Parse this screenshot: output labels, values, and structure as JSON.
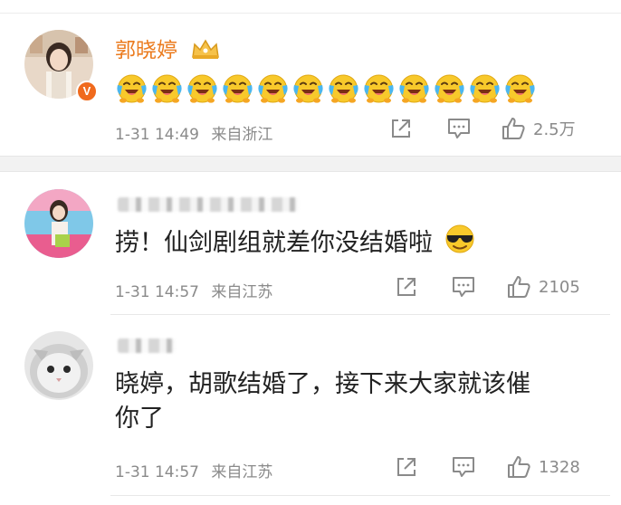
{
  "comments": [
    {
      "username": "郭晓婷",
      "emoji_count": 12,
      "emoji_name": "laughing-tears-emoji",
      "time": "1-31 14:49",
      "source": "来自浙江",
      "likes": "2.5万"
    },
    {
      "username": "",
      "text": "捞！仙剑剧组就差你没结婚啦",
      "trailing_emoji": "sunglasses-emoji",
      "time": "1-31 14:57",
      "source": "来自江苏",
      "likes": "2105"
    },
    {
      "username": "",
      "text_line1": "晓婷，胡歌结婚了，接下来大家就该催",
      "text_line2": "你了",
      "time": "1-31 14:57",
      "source": "来自江苏",
      "likes": "1328"
    }
  ],
  "colors": {
    "username": "#eb7b1e",
    "meta": "#8a8a8a",
    "verified_badge": "#f06a1d"
  },
  "icons": [
    "share-icon",
    "comment-icon",
    "like-icon",
    "crown-icon",
    "verified-badge-icon"
  ]
}
